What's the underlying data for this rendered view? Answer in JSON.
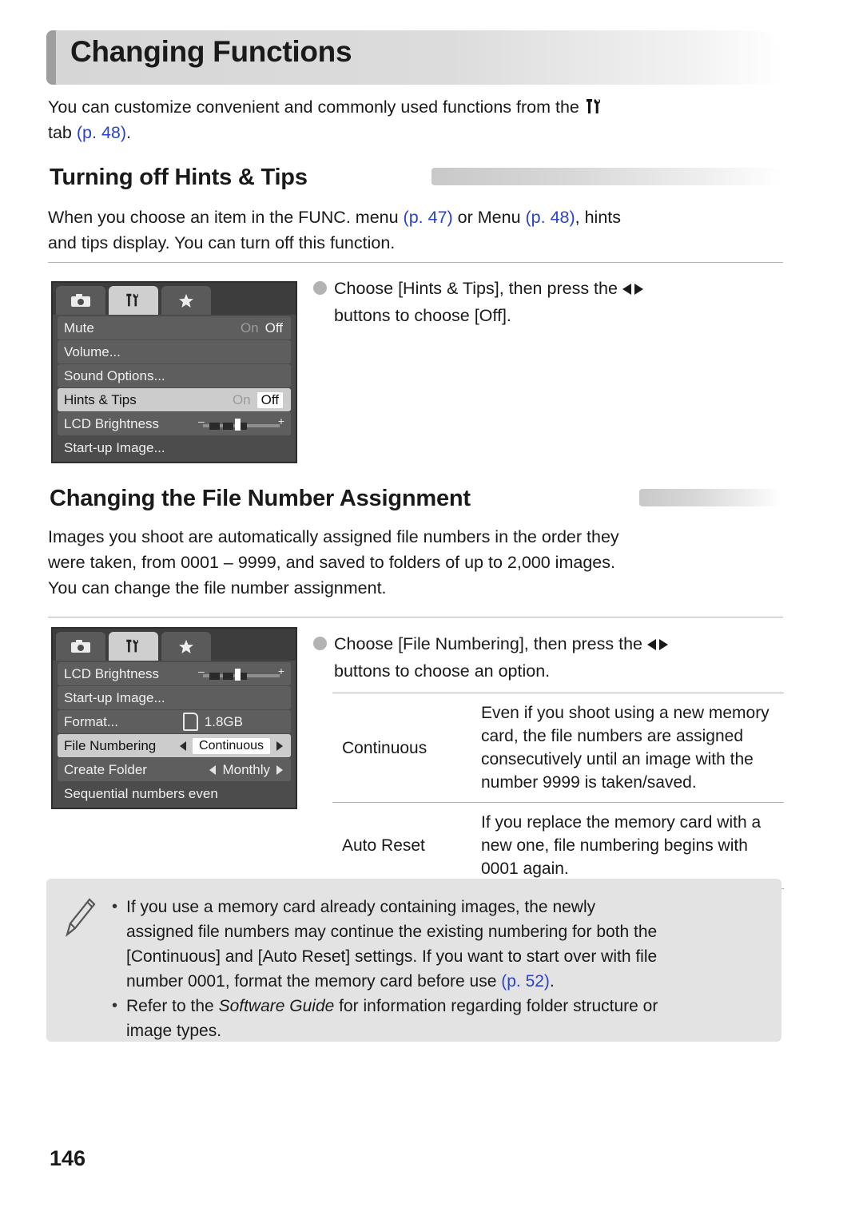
{
  "page": {
    "title": "Changing Functions",
    "number": "146"
  },
  "intro": {
    "line1_a": "You can customize convenient and commonly used functions from the ",
    "line1_icon": "menu-wrench-icon",
    "line2_a": "tab ",
    "line2_link": "(p. 48)",
    "line2_b": "."
  },
  "section1": {
    "heading": "Turning off Hints & Tips",
    "body_a": "When you choose an item in the FUNC. menu ",
    "body_link1": "(p. 47)",
    "body_b": " or Menu ",
    "body_link2": "(p. 48)",
    "body_c": ", hints",
    "body_line2": "and tips display. You can turn off this function.",
    "instruction_a": "Choose [Hints & Tips], then press the ",
    "instruction_b": "buttons to choose [Off].",
    "lcd": {
      "tabs": [
        "camera-tab",
        "wrench-tab",
        "star-tab"
      ],
      "rows": [
        {
          "label": "Mute",
          "value_on": "On",
          "value_off": "Off",
          "selected": false,
          "type": "onoff"
        },
        {
          "label": "Volume...",
          "value": "",
          "selected": false,
          "type": "plain"
        },
        {
          "label": "Sound Options...",
          "value": "",
          "selected": false,
          "type": "plain"
        },
        {
          "label": "Hints & Tips",
          "value_on": "On",
          "value_off": "Off",
          "selected": true,
          "type": "onoff"
        },
        {
          "label": "LCD Brightness",
          "value": "",
          "selected": false,
          "type": "slider"
        },
        {
          "label": "Start-up Image...",
          "value": "",
          "selected": false,
          "type": "plain"
        }
      ]
    }
  },
  "section2": {
    "heading": "Changing the File Number Assignment",
    "body_line1": "Images you shoot are automatically assigned file numbers in the order they",
    "body_line2": "were taken, from 0001 – 9999, and saved to folders of up to 2,000 images.",
    "body_line3": "You can change the file number assignment.",
    "instruction_a": "Choose [File Numbering], then press the ",
    "instruction_b": "buttons to choose an option.",
    "lcd": {
      "tabs": [
        "camera-tab",
        "wrench-tab",
        "star-tab"
      ],
      "rows": [
        {
          "label": "LCD Brightness",
          "value": "",
          "selected": false,
          "type": "slider"
        },
        {
          "label": "Start-up Image...",
          "value": "",
          "selected": false,
          "type": "plain"
        },
        {
          "label": "Format...",
          "value": "1.8GB",
          "selected": false,
          "type": "card"
        },
        {
          "label": "File Numbering",
          "value": "Continuous",
          "selected": true,
          "type": "option"
        },
        {
          "label": "Create Folder",
          "value": "Monthly",
          "selected": false,
          "type": "option"
        },
        {
          "label": "Sequential numbers even",
          "value": "",
          "selected": false,
          "type": "hint"
        }
      ]
    },
    "table": {
      "rows": [
        {
          "name": "Continuous",
          "desc": "Even if you shoot using a new memory card, the file numbers are assigned consecutively until an image with the number 9999 is taken/saved."
        },
        {
          "name": "Auto Reset",
          "desc": "If you replace the memory card with a new one, file numbering begins with 0001 again."
        }
      ]
    }
  },
  "note": {
    "bullet1_l1": "If you use a memory card already containing images, the newly",
    "bullet1_l2": "assigned file numbers may continue the existing numbering for both the",
    "bullet1_l3": "[Continuous] and [Auto Reset] settings. If you want to start over with file",
    "bullet1_l4_a": "number 0001, format the memory card before use ",
    "bullet1_l4_link": "(p. 52)",
    "bullet1_l4_b": ".",
    "bullet2_a": "Refer to the ",
    "bullet2_italic": "Software Guide",
    "bullet2_b": " for information regarding folder structure or",
    "bullet2_l2": "image types.",
    "bullet_char": "•"
  },
  "colors": {
    "link": "#2b43c8",
    "note_bg": "#e3e3e3",
    "rule": "#b4b4b4"
  }
}
